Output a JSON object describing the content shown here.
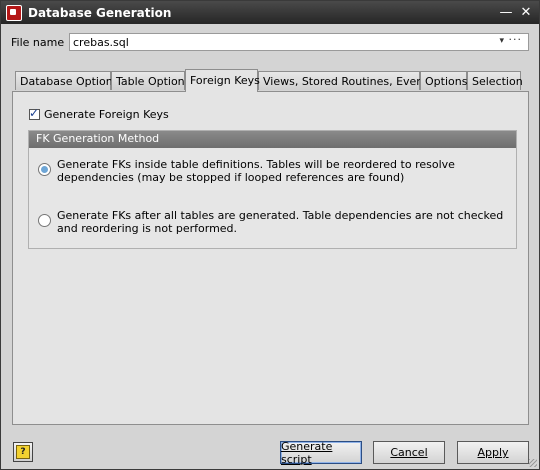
{
  "window": {
    "title": "Database Generation"
  },
  "file": {
    "label": "File name",
    "value": "crebas.sql",
    "browse_glyph": "···",
    "dropdown_glyph": "▾"
  },
  "tabs": [
    {
      "label": "Database Options",
      "active": false
    },
    {
      "label": "Table Options",
      "active": false
    },
    {
      "label": "Foreign Keys",
      "active": true
    },
    {
      "label": "Views, Stored Routines, Events",
      "active": false
    },
    {
      "label": "Options",
      "active": false
    },
    {
      "label": "Selection",
      "active": false
    }
  ],
  "foreign_keys": {
    "generate_label": "Generate Foreign Keys",
    "generate_checked": true,
    "method_title": "FK Generation Method",
    "options": [
      {
        "label": "Generate FKs inside table definitions. Tables will be reordered to resolve dependencies (may be stopped if looped references are found)",
        "selected": true
      },
      {
        "label": "Generate FKs after all tables are generated. Table dependencies are not checked and reordering is not performed.",
        "selected": false
      }
    ]
  },
  "buttons": {
    "generate": "Generate script",
    "cancel": "Cancel",
    "apply": "Apply",
    "help_glyph": "?"
  },
  "icons": {
    "app": "database-app-icon",
    "minimize": "minimize-icon",
    "close": "close-icon",
    "help": "help-icon"
  }
}
